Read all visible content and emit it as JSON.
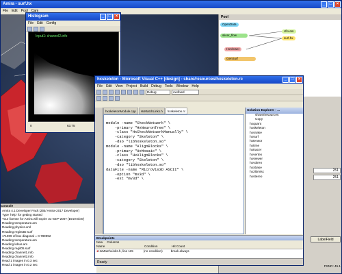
{
  "amira": {
    "title": "Amira - surf.hx",
    "menu": [
      "File",
      "Edit",
      "Pool",
      "Cam"
    ]
  },
  "pool": {
    "header": "Pool",
    "modules": [
      {
        "label": "OpenData",
        "color": "#7fd7f7"
      },
      {
        "label": "cflo.am",
        "color": "#d4f39d"
      },
      {
        "label": "slicer_flow",
        "color": "#9ce38b"
      },
      {
        "label": "surf.hx",
        "color": "#ffe46b"
      },
      {
        "label": "HxViewer",
        "color": "#efa7a7"
      },
      {
        "label": "GenSurf",
        "color": "#f2c56b"
      }
    ]
  },
  "props": {
    "value_a": "251",
    "value_b": "251",
    "button": "LabelField",
    "psnr": "PSNR: 45.1"
  },
  "histogram": {
    "title": "Histogram",
    "menu": [
      "File",
      "Edit",
      "Config"
    ],
    "label": "Input1: channel2.info",
    "x_ticks": [
      "0",
      "63.75",
      "0"
    ]
  },
  "console": {
    "header": "Console",
    "lines": [
      "Amira 4.1 Developer Pack (ZIB/ Amira-2017 Developer)",
      "Type 'help' for getting started",
      "Your license for Amira will expire 31-SEP-2007 (Dezember)",
      "Reading temperature.am",
      "Reading physics.xml",
      "Reading regist3D.surf",
      "1*1009 of box diagonal = 0.789992",
      "Reading temperature.am",
      "Reading lobus.am",
      "Reading regit05.surf",
      "Reading channel1.info",
      "Reading channel2.info",
      "Read 1 images in 0.3 sec",
      "Read 1 images in 0.2 sec"
    ]
  },
  "vcpp": {
    "title": "hxskeleton - Microsoft Visual C++ [design] - share/resources/hxskeleton.rc",
    "menu": [
      "File",
      "Edit",
      "View",
      "Project",
      "Build",
      "Debug",
      "Tools",
      "Window",
      "Help"
    ],
    "config": "Debug",
    "search": "cxxfixed",
    "tabs": [
      "hxskeletonModule.cpp",
      "HxMatchLinks.h",
      "hxskeleton.rc"
    ],
    "code": [
      "module -name \"CheckNetwork\" \\",
      "    -primary \"HxNeuronTree\" \\",
      "    -class \"HxCheckNetworkManually\" \\",
      "    -category \"Skeleton\" \\",
      "    -dso \"libhxskeleton.so\"",
      "",
      "module -name \"AlignBlocks\" \\",
      "    -primary \"HxMosaic\" \\",
      "    -class \"HxAlignBlocks\" \\",
      "    -category \"Skeleton\" \\",
      "    -dso \"libhxskeleton.so\"",
      "",
      "dataFile -name \"MicroVis3D ASCII\" \\",
      "    -option \"mv3d\" \\",
      "    -ext \"mv3d\" \\"
    ],
    "solution": {
      "header": "Solution Explorer - ...",
      "items": [
        "share/resources",
        "Copy",
        "hxquant",
        "hxskeleton",
        "hxsnake",
        "hxsurf",
        "hxtensor",
        "hxtime",
        "hxtracer",
        "hxvertex",
        "hxviewer",
        "hxvolren",
        "hxxbase",
        "hxzibmisc",
        "hxstereo"
      ]
    },
    "breakpoints": {
      "header": "Breakpoints",
      "new": "New",
      "columns": "Columns",
      "cols": [
        "Name",
        "Condition",
        "Hit Count"
      ],
      "rows": [
        {
          "name": "HxMatchLinks.h, line 115",
          "condition": "(no condition)",
          "hits": "break always"
        },
        {
          "name": "hxskeleton.rc, line 23",
          "condition": "(no condition)",
          "hits": "break always"
        }
      ]
    },
    "status": "Ready"
  }
}
